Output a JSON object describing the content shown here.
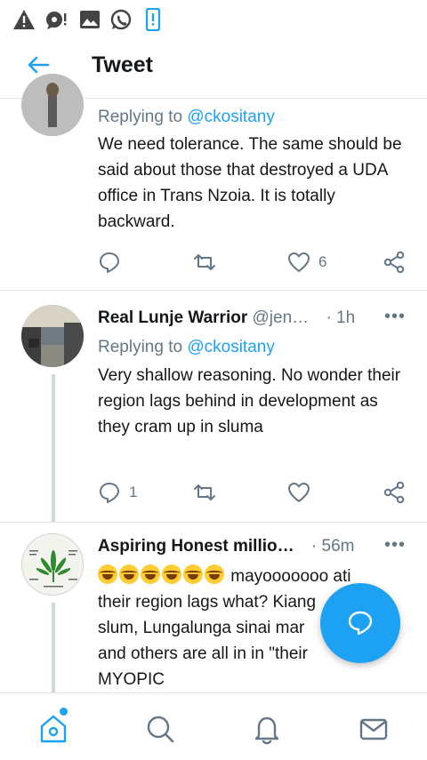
{
  "status_bar": {
    "icons": [
      "warning-icon",
      "chat-bubble-alert-icon",
      "image-icon",
      "whatsapp-icon",
      "phone-alert-icon"
    ]
  },
  "app_bar": {
    "title": "Tweet",
    "back_icon": "back-arrow-icon"
  },
  "tweets": [
    {
      "replying_prefix": "Replying to",
      "replying_to": "@ckositany",
      "text": "We need tolerance. The same should be said about those that destroyed a UDA office in Trans Nzoia. It is totally backward.",
      "actions": {
        "reply_count": "",
        "retweet_count": "",
        "like_count": "6"
      }
    },
    {
      "name": "Real Lunje Warrior",
      "handle": "@jen…",
      "separator": "·",
      "time": "1h",
      "replying_prefix": "Replying to",
      "replying_to": "@ckositany",
      "text": "Very shallow reasoning. No wonder their region lags behind in development as they cram up in sluma",
      "actions": {
        "reply_count": "1",
        "retweet_count": "",
        "like_count": ""
      }
    },
    {
      "name": "Aspiring Honest millio…",
      "handle": "",
      "separator": "·",
      "time": "56m",
      "text_after_emoji": "mayooooooo ati",
      "text_lines": [
        "their region lags what? Kiang",
        "slum, Lungalunga sinai mar",
        "and others are all in in \"their",
        "MYOPIC"
      ],
      "avatar_lettering": "ANATOMY OF MARIJUANA"
    }
  ],
  "fab": {
    "icon": "compose-reply-icon"
  },
  "bottom_nav": {
    "items": [
      "home-icon",
      "search-icon",
      "notifications-icon",
      "messages-icon"
    ]
  },
  "colors": {
    "accent": "#1da1f2",
    "text": "#14171a",
    "muted": "#657786",
    "divider": "#e1e8ed"
  }
}
